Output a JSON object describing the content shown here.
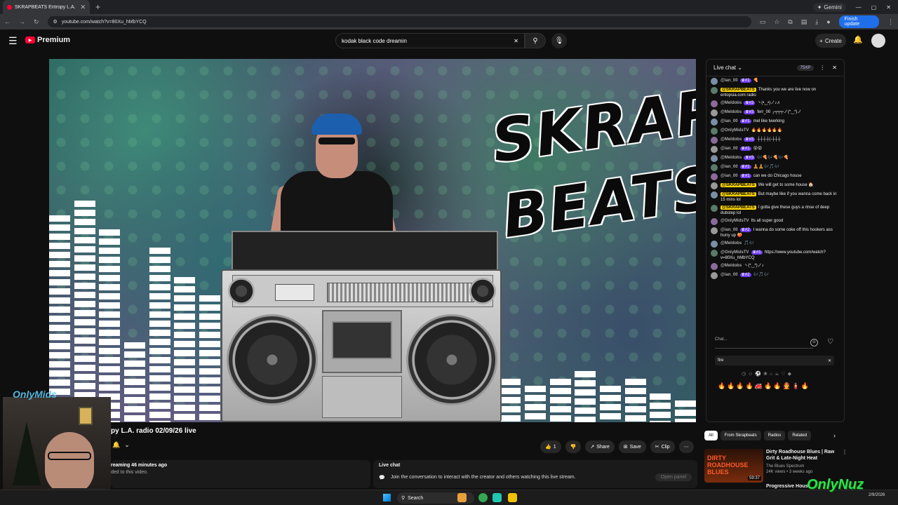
{
  "browser": {
    "tab_title": "SKRAPBEATS Entropy L.A.",
    "url": "youtube.com/watch?v=80Xu_hMbYCQ",
    "gemini_label": "Gemini",
    "update_label": "Finish update"
  },
  "youtube": {
    "logo_text": "Premium",
    "search_value": "kodak black code dreamin",
    "create_label": "Create"
  },
  "video": {
    "brand_text": "SKRAP BEATS",
    "title": "py L.A. radio 02/09/26 live",
    "likes": "1",
    "share_label": "Share",
    "save_label": "Save",
    "clip_label": "Clip",
    "desc_line1": "reaming 46 minutes ago",
    "desc_line2": "ded to this video.",
    "eq_levels": [
      0.57,
      0.61,
      0.53,
      0.22,
      0.48,
      0.4,
      0.35,
      0.22,
      0.18,
      0.14,
      0.12,
      0.14,
      0.16,
      0.1,
      0.14,
      0.18,
      0.12,
      0.15,
      0.12,
      0.1,
      0.12,
      0.14,
      0.1,
      0.12,
      0.08,
      0.06
    ]
  },
  "livechat_box": {
    "heading": "Live chat",
    "text": "Join the conversation to interact with the creator and others watching this live stream.",
    "button": "Open panel"
  },
  "chat": {
    "header": "Live chat",
    "xp": "75XP",
    "messages": [
      {
        "author": "@ian_00",
        "badge": "#1",
        "text": "🍕",
        "owner": false
      },
      {
        "author": "@SKRAPBEATS",
        "badge": "",
        "text": "Thanks you we are live now on entopsia.com radio",
        "owner": true
      },
      {
        "author": "@Meldobs",
        "badge": "#3",
        "text": "ヽ(•‿•)ノ♪♬",
        "owner": false
      },
      {
        "author": "@Meldobs",
        "badge": "#3",
        "text": "ferr_00 ┌╤╤╤ノ(*‿*)ノ",
        "owner": false
      },
      {
        "author": "@ian_00",
        "badge": "#1",
        "text": "mel like twerking",
        "owner": false
      },
      {
        "author": "@OnlyMidsTV",
        "badge": "",
        "text": "🔥🔥🔥🔥🔥🔥",
        "owner": false
      },
      {
        "author": "@Meldobs",
        "badge": "#3",
        "text": "┼┼┼┼(-┼┼┼",
        "owner": false
      },
      {
        "author": "@ian_00",
        "badge": "#1",
        "text": "😵😵",
        "owner": false
      },
      {
        "author": "@Meldobs",
        "badge": "#3",
        "text": "🎶🍕🎶🍕🎶🍕",
        "owner": false
      },
      {
        "author": "@ian_00",
        "badge": "#1",
        "text": "🧘🧘🎶🎵🎶",
        "owner": false
      },
      {
        "author": "@ian_00",
        "badge": "#1",
        "text": "can we do Chicago house",
        "owner": false
      },
      {
        "author": "@SKRAPBEATS",
        "badge": "",
        "text": "We will get to some house 🏠",
        "owner": true
      },
      {
        "author": "@SKRAPBEATS",
        "badge": "",
        "text": "But maybe like if you wanna come back in 15 mins lol",
        "owner": true
      },
      {
        "author": "@SKRAPBEATS",
        "badge": "",
        "text": "I gotta give these guys a rinse of deep dubstep lol",
        "owner": true
      },
      {
        "author": "@OnlyMidsTV",
        "badge": "",
        "text": "Its all super good",
        "owner": false
      },
      {
        "author": "@ian_00",
        "badge": "#2",
        "text": "I wanna do some coke off this hookers ass hurry up 🍑",
        "owner": false
      },
      {
        "author": "@Meldobs",
        "badge": "",
        "text": "🎵🎶",
        "owner": false
      },
      {
        "author": "@OnlyMidsTV",
        "badge": "#1",
        "text": "https://www.youtube.com/watch?v=80Xu_hMbYCQ",
        "owner": false
      },
      {
        "author": "@Meldobs",
        "badge": "",
        "text": "ヽ(*‿*)ノ♪",
        "owner": false
      },
      {
        "author": "@ian_00",
        "badge": "#2",
        "text": "🎶🎵🎶",
        "owner": false
      }
    ],
    "input_placeholder": "Chat...",
    "emoji_search": "fire",
    "emoji_row": "🔥🔥🔥🔥🚒🔥🔥🧑‍🚒🧯🔥"
  },
  "related": {
    "chips": [
      "All",
      "From Skrapbeats",
      "Radios",
      "Related"
    ],
    "item1": {
      "thumb_text": "DIRTY ROADHOUSE BLUES",
      "duration": "59:37",
      "title": "Dirty Roadhouse Blues | Raw Grit & Late-Night Heat",
      "channel": "The Blues Spectrum",
      "meta": "24K views • 3 weeks ago"
    },
    "item2_title": "Progressive House"
  },
  "overlays": {
    "cam_logo": "OnlyMids",
    "corner_logo": "OnlyNuz"
  },
  "taskbar": {
    "search": "Search",
    "clock": "2/9/2026"
  }
}
